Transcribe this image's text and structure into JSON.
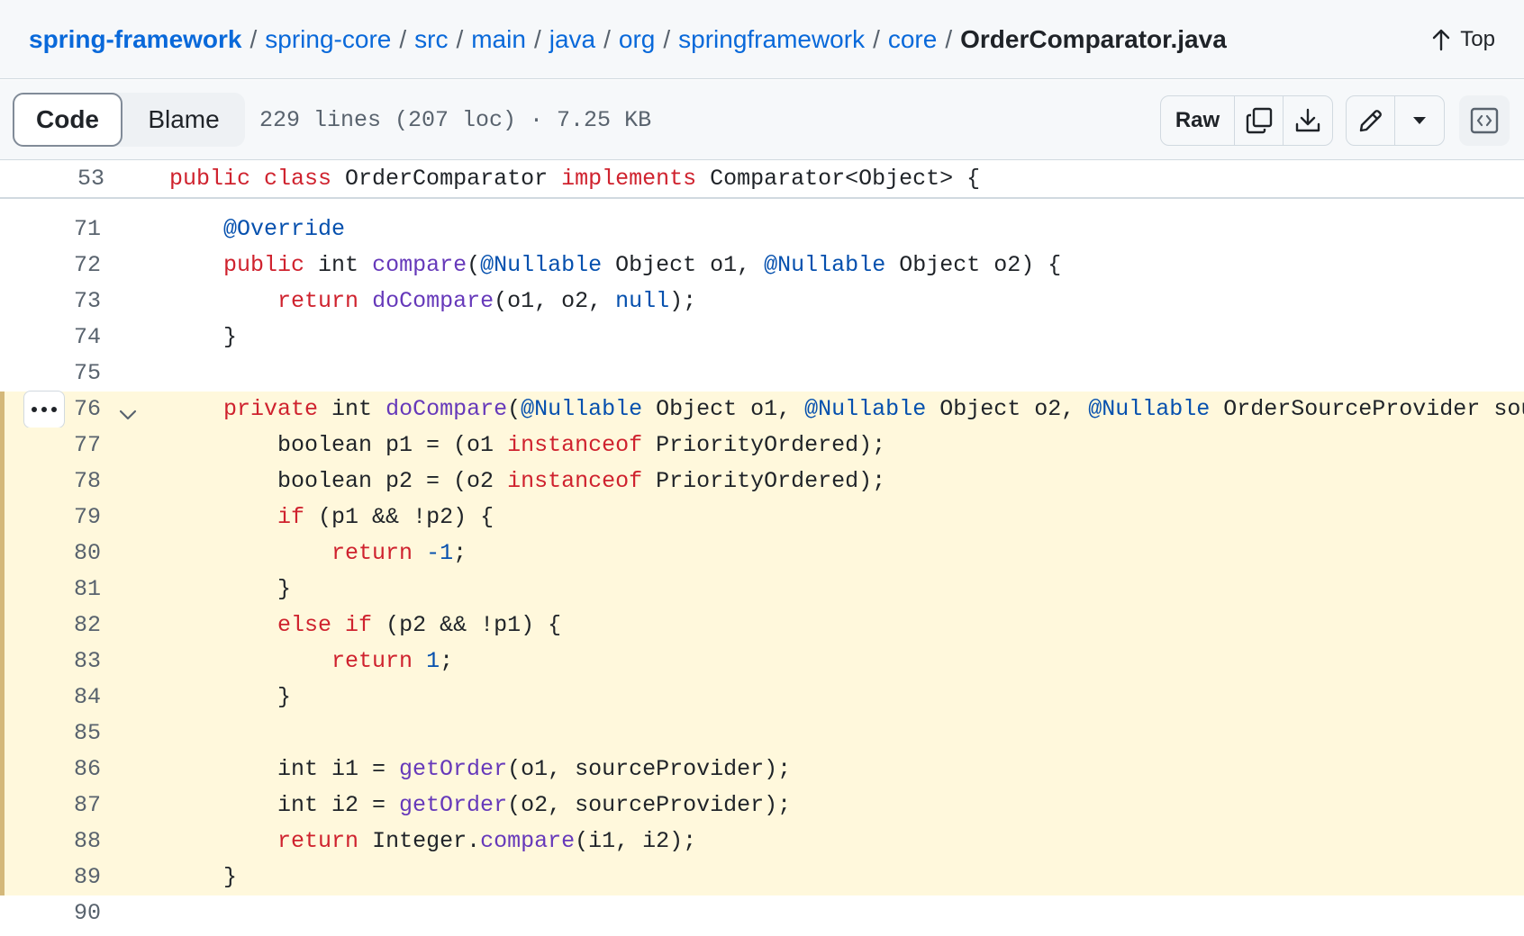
{
  "breadcrumb": {
    "items": [
      "spring-framework",
      "spring-core",
      "src",
      "main",
      "java",
      "org",
      "springframework",
      "core"
    ],
    "separator": "/",
    "file": "OrderComparator.java"
  },
  "top_button": {
    "label": "Top",
    "icon": "arrow-up-icon"
  },
  "toolbar": {
    "tabs": {
      "code": "Code",
      "blame": "Blame"
    },
    "file_info": "229 lines (207 loc) · 7.25 KB",
    "raw_label": "Raw",
    "icons": [
      "copy-icon",
      "download-icon",
      "pencil-icon",
      "triangle-down-icon",
      "code-square-icon"
    ]
  },
  "sticky_line": {
    "number": "53",
    "tokens": [
      [
        "k",
        "public "
      ],
      [
        "k",
        "class "
      ],
      [
        "",
        "OrderComparator "
      ],
      [
        "k",
        "implements "
      ],
      [
        "",
        "Comparator<Object> {"
      ]
    ]
  },
  "code_lines": [
    {
      "n": "71",
      "hl": false,
      "t": [
        [
          "",
          "    "
        ],
        [
          "c",
          "@Override"
        ]
      ]
    },
    {
      "n": "72",
      "hl": false,
      "t": [
        [
          "",
          "    "
        ],
        [
          "k",
          "public "
        ],
        [
          "",
          "int "
        ],
        [
          "f",
          "compare"
        ],
        [
          "",
          "("
        ],
        [
          "c",
          "@Nullable"
        ],
        [
          "",
          " Object o1, "
        ],
        [
          "c",
          "@Nullable"
        ],
        [
          "",
          " Object o2) {"
        ]
      ]
    },
    {
      "n": "73",
      "hl": false,
      "t": [
        [
          "",
          "        "
        ],
        [
          "k",
          "return "
        ],
        [
          "f",
          "doCompare"
        ],
        [
          "",
          "(o1, o2, "
        ],
        [
          "c",
          "null"
        ],
        [
          "",
          ");"
        ]
      ]
    },
    {
      "n": "74",
      "hl": false,
      "t": [
        [
          "",
          "    }"
        ]
      ]
    },
    {
      "n": "75",
      "hl": false,
      "t": []
    },
    {
      "n": "76",
      "hl": true,
      "fold": true,
      "t": [
        [
          "",
          "    "
        ],
        [
          "k",
          "private "
        ],
        [
          "",
          "int "
        ],
        [
          "f",
          "doCompare"
        ],
        [
          "",
          "("
        ],
        [
          "c",
          "@Nullable"
        ],
        [
          "",
          " Object o1, "
        ],
        [
          "c",
          "@Nullable"
        ],
        [
          "",
          " Object o2, "
        ],
        [
          "c",
          "@Nullable"
        ],
        [
          "",
          " OrderSourceProvider sourceProvider) {"
        ]
      ]
    },
    {
      "n": "77",
      "hl": true,
      "t": [
        [
          "",
          "        boolean p1 = (o1 "
        ],
        [
          "k",
          "instanceof"
        ],
        [
          "",
          " PriorityOrdered);"
        ]
      ]
    },
    {
      "n": "78",
      "hl": true,
      "t": [
        [
          "",
          "        boolean p2 = (o2 "
        ],
        [
          "k",
          "instanceof"
        ],
        [
          "",
          " PriorityOrdered);"
        ]
      ]
    },
    {
      "n": "79",
      "hl": true,
      "t": [
        [
          "",
          "        "
        ],
        [
          "k",
          "if"
        ],
        [
          "",
          " (p1 && !p2) {"
        ]
      ]
    },
    {
      "n": "80",
      "hl": true,
      "t": [
        [
          "",
          "            "
        ],
        [
          "k",
          "return "
        ],
        [
          "c",
          "-1"
        ],
        [
          "",
          ";"
        ]
      ]
    },
    {
      "n": "81",
      "hl": true,
      "t": [
        [
          "",
          "        }"
        ]
      ]
    },
    {
      "n": "82",
      "hl": true,
      "t": [
        [
          "",
          "        "
        ],
        [
          "k",
          "else if"
        ],
        [
          "",
          " (p2 && !p1) {"
        ]
      ]
    },
    {
      "n": "83",
      "hl": true,
      "t": [
        [
          "",
          "            "
        ],
        [
          "k",
          "return "
        ],
        [
          "c",
          "1"
        ],
        [
          "",
          ";"
        ]
      ]
    },
    {
      "n": "84",
      "hl": true,
      "t": [
        [
          "",
          "        }"
        ]
      ]
    },
    {
      "n": "85",
      "hl": true,
      "t": []
    },
    {
      "n": "86",
      "hl": true,
      "t": [
        [
          "",
          "        int i1 = "
        ],
        [
          "f",
          "getOrder"
        ],
        [
          "",
          "(o1, sourceProvider);"
        ]
      ]
    },
    {
      "n": "87",
      "hl": true,
      "t": [
        [
          "",
          "        int i2 = "
        ],
        [
          "f",
          "getOrder"
        ],
        [
          "",
          "(o2, sourceProvider);"
        ]
      ]
    },
    {
      "n": "88",
      "hl": true,
      "t": [
        [
          "",
          "        "
        ],
        [
          "k",
          "return "
        ],
        [
          "",
          "Integer."
        ],
        [
          "f",
          "compare"
        ],
        [
          "",
          "(i1, i2);"
        ]
      ]
    },
    {
      "n": "89",
      "hl": true,
      "t": [
        [
          "",
          "    }"
        ]
      ]
    },
    {
      "n": "90",
      "hl": false,
      "t": []
    }
  ]
}
